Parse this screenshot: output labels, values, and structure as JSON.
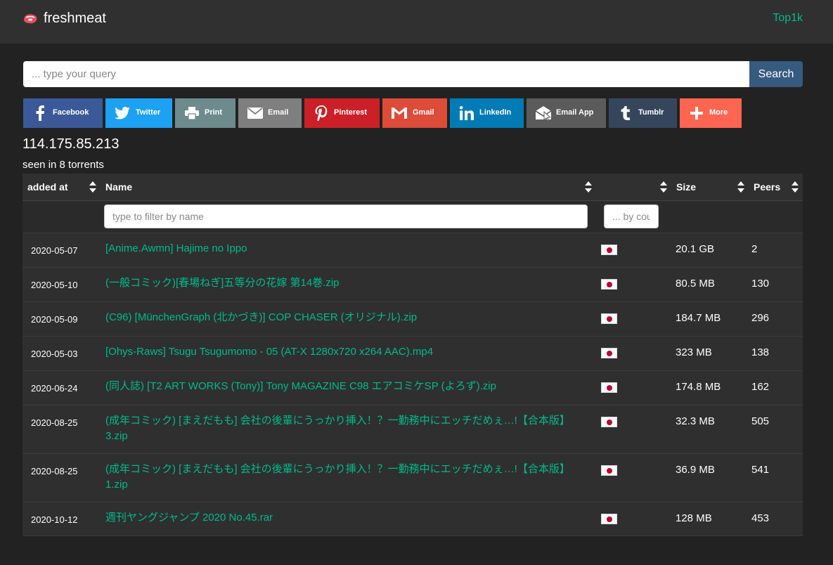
{
  "navbar": {
    "brand": "freshmeat",
    "top_link": "Top1k"
  },
  "search": {
    "placeholder": "... type your query",
    "button_label": "Search"
  },
  "share": [
    {
      "label": "Facebook",
      "icon": "facebook-icon",
      "color": "#3b5998"
    },
    {
      "label": "Twitter",
      "icon": "twitter-icon",
      "color": "#1da1f2"
    },
    {
      "label": "Print",
      "icon": "print-icon",
      "color": "#6d8b8d"
    },
    {
      "label": "Email",
      "icon": "email-icon",
      "color": "#7f7f7f"
    },
    {
      "label": "Pinterest",
      "icon": "pinterest-icon",
      "color": "#cb2027"
    },
    {
      "label": "Gmail",
      "icon": "gmail-icon",
      "color": "#dd4b39"
    },
    {
      "label": "LinkedIn",
      "icon": "linkedin-icon",
      "color": "#007bb5"
    },
    {
      "label": "Email App",
      "icon": "email-app-icon",
      "color": "#5b5b5b"
    },
    {
      "label": "Tumblr",
      "icon": "tumblr-icon",
      "color": "#35465c"
    },
    {
      "label": "More",
      "icon": "plus-icon",
      "color": "#ff6550"
    }
  ],
  "ip": "114.175.85.213",
  "seen": "seen in 8 torrents",
  "table": {
    "headers": {
      "added": "added at",
      "name": "Name",
      "country": "",
      "size": "Size",
      "peers": "Peers"
    },
    "filters": {
      "name_placeholder": "type to filter by name",
      "country_placeholder": "... by country"
    },
    "rows": [
      {
        "date": "2020-05-07",
        "name": "[Anime.Awmn] Hajime no Ippo",
        "country": "JP",
        "size": "20.1 GB",
        "peers": "2"
      },
      {
        "date": "2020-05-10",
        "name": "(一般コミック)[春場ねぎ]五等分の花嫁 第14巻.zip",
        "country": "JP",
        "size": "80.5 MB",
        "peers": "130"
      },
      {
        "date": "2020-05-09",
        "name": "(C96) [MünchenGraph (北かづき)] COP CHASER (オリジナル).zip",
        "country": "JP",
        "size": "184.7 MB",
        "peers": "296"
      },
      {
        "date": "2020-05-03",
        "name": "[Ohys-Raws] Tsugu Tsugumomo - 05 (AT-X 1280x720 x264 AAC).mp4",
        "country": "JP",
        "size": "323 MB",
        "peers": "138"
      },
      {
        "date": "2020-06-24",
        "name": "(同人誌) [T2 ART WORKS (Tony)] Tony MAGAZINE C98 エアコミケSP (よろず).zip",
        "country": "JP",
        "size": "174.8 MB",
        "peers": "162"
      },
      {
        "date": "2020-08-25",
        "name": "(成年コミック) [まえだもも] 会社の後輩にうっかり挿入！？一勤務中にエッチだめぇ…!【合本版】3.zip",
        "country": "JP",
        "size": "32.3 MB",
        "peers": "505"
      },
      {
        "date": "2020-08-25",
        "name": "(成年コミック) [まえだもも] 会社の後輩にうっかり挿入！？一勤務中にエッチだめぇ…!【合本版】1.zip",
        "country": "JP",
        "size": "36.9 MB",
        "peers": "541"
      },
      {
        "date": "2020-10-12",
        "name": "週刊ヤングジャンプ 2020 No.45.rar",
        "country": "JP",
        "size": "128 MB",
        "peers": "453"
      }
    ]
  }
}
